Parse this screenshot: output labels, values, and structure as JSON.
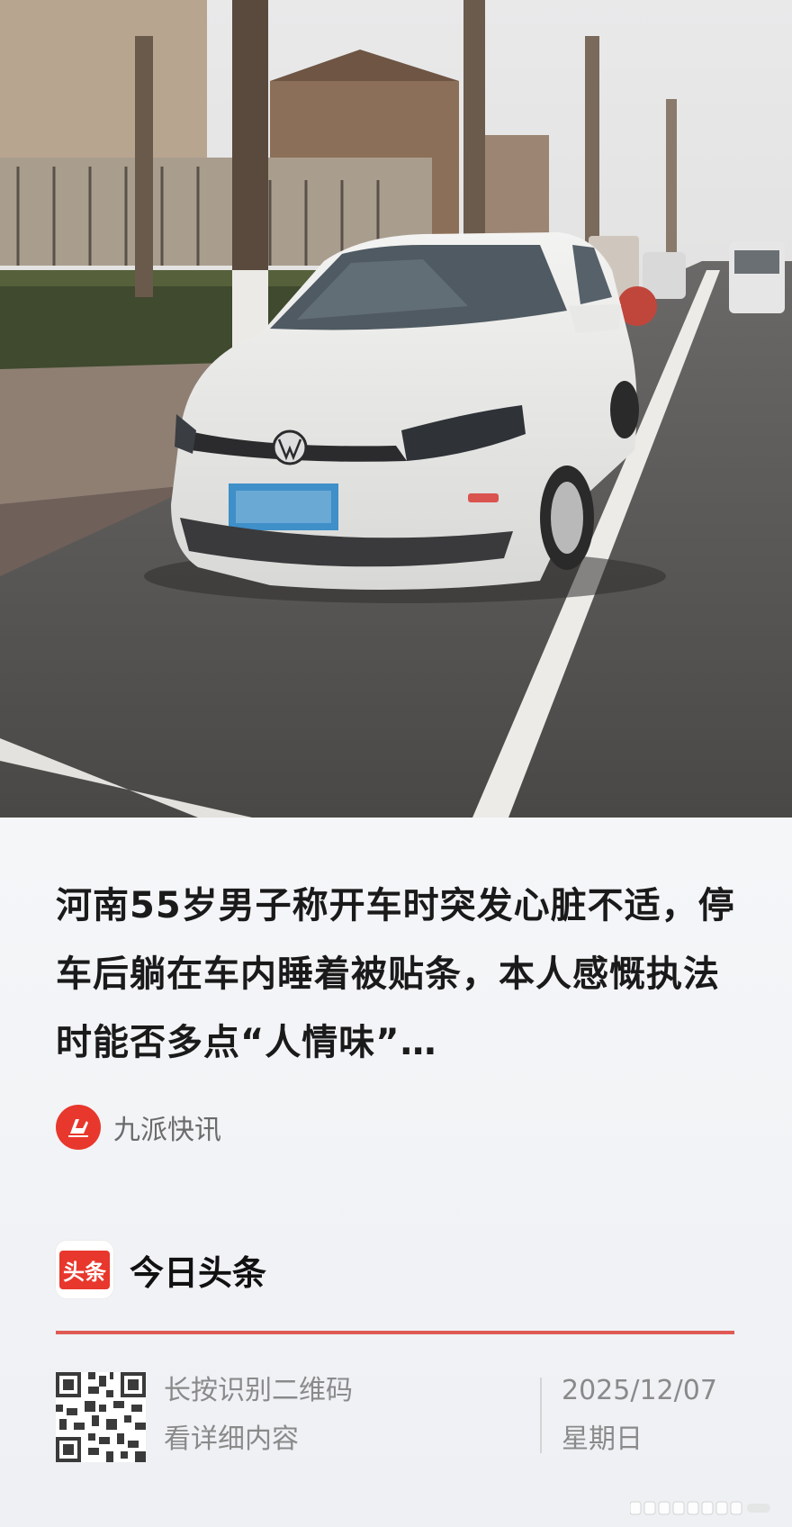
{
  "article": {
    "headline": "河南55岁男子称开车时突发心脏不适，停车后躺在车内睡着被贴条，本人感慨执法时能否多点“人情味”…",
    "source": {
      "name": "九派快讯",
      "logo_icon": "jiupai-logo-icon"
    }
  },
  "brand": {
    "badge_text": "头条",
    "name": "今日头条",
    "accent_color": "#e8372c"
  },
  "footer": {
    "qr_hint_line1": "长按识别二维码",
    "qr_hint_line2": "看详细内容",
    "date": "2025/12/07",
    "weekday": "星期日"
  }
}
